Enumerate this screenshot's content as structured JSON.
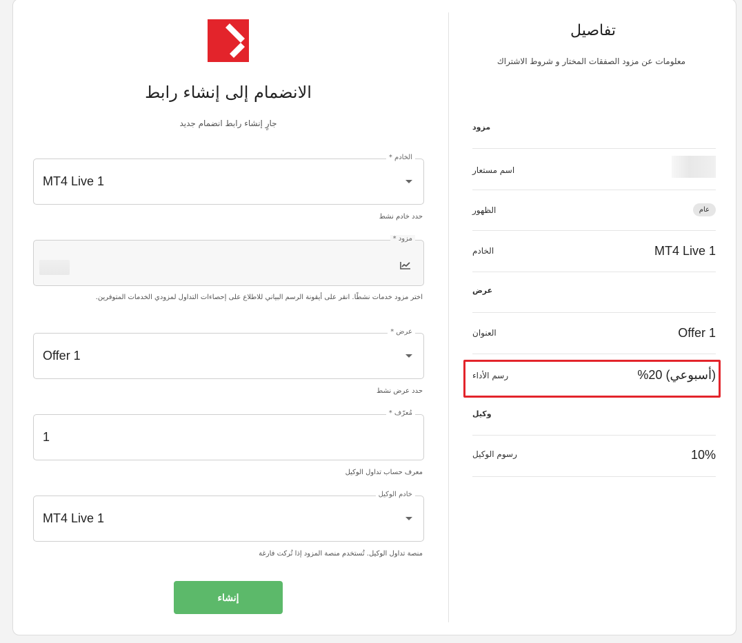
{
  "form": {
    "title": "الانضمام إلى إنشاء رابط",
    "subtitle": "جارٍ إنشاء رابط انضمام جديد",
    "server": {
      "label": "الخادم *",
      "value": "MT4 Live 1",
      "helper": "حدد خادم نشط"
    },
    "provider": {
      "label": "مزود *",
      "helper": "اختر مزود خدمات نشطًا. انقر على أيقونة الرسم البياني للاطلاع على إحصاءات التداول لمزودي الخدمات المتوفرين."
    },
    "offer": {
      "label": "عرض *",
      "value": "Offer 1",
      "helper": "حدد عرض نشط"
    },
    "identifier": {
      "label": "مُعرّف *",
      "value": "1",
      "helper": "معرف حساب تداول الوكيل"
    },
    "agent_server": {
      "label": "خادم الوكيل",
      "value": "MT4 Live 1",
      "helper": "منصة تداول الوكيل. تُستخدم منصة المزود إذا تُركت فارغة"
    },
    "submit_label": "إنشاء"
  },
  "details": {
    "title": "تفاصيل",
    "description": "معلومات عن مزود الصفقات المختار و شروط الاشتراك",
    "provider_section": "مزود",
    "nickname_label": "اسم مستعار",
    "visibility_label": "الظهور",
    "visibility_value": "عام",
    "server_label": "الخادم",
    "server_value": "MT4 Live 1",
    "offer_section": "عرض",
    "name_label": "العنوان",
    "name_value": "Offer 1",
    "perf_fee_label": "رسم الأداء",
    "perf_fee_value": "(أسبوعي) 20%",
    "agent_section": "وكيل",
    "agent_fee_label": "رسوم الوكيل",
    "agent_fee_value": "10%"
  },
  "colors": {
    "accent_red": "#e3242b",
    "submit_green": "#5cb96a"
  },
  "icons": {
    "logo": "brand-logo",
    "dropdown": "chevron-down-icon",
    "stats": "chart-icon"
  }
}
